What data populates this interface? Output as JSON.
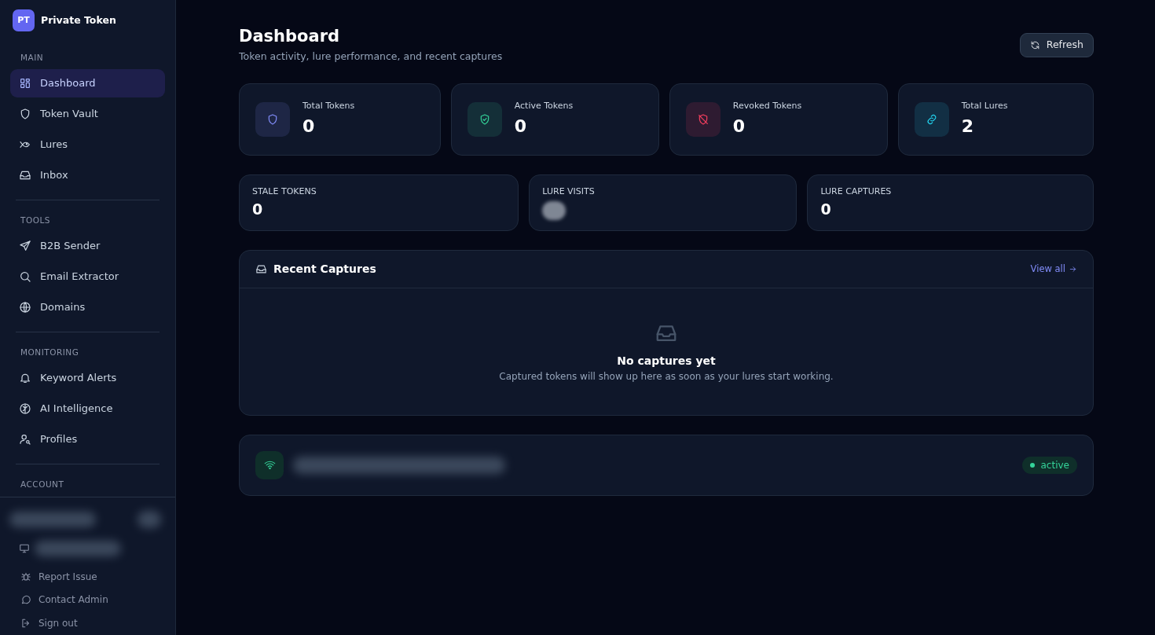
{
  "brand": {
    "initials": "PT",
    "name": "Private Token"
  },
  "sidebar": {
    "sections": [
      {
        "heading": "MAIN",
        "items": [
          {
            "label": "Dashboard",
            "selected": true
          },
          {
            "label": "Token Vault",
            "selected": false
          },
          {
            "label": "Lures",
            "selected": false
          },
          {
            "label": "Inbox",
            "selected": false
          }
        ]
      },
      {
        "heading": "TOOLS",
        "items": [
          {
            "label": "B2B Sender",
            "selected": false
          },
          {
            "label": "Email Extractor",
            "selected": false
          },
          {
            "label": "Domains",
            "selected": false
          }
        ]
      },
      {
        "heading": "MONITORING",
        "items": [
          {
            "label": "Keyword Alerts",
            "selected": false
          },
          {
            "label": "AI Intelligence",
            "selected": false
          },
          {
            "label": "Profiles",
            "selected": false
          }
        ]
      },
      {
        "heading": "ACCOUNT"
      }
    ],
    "footer_links": [
      {
        "label": "Report Issue"
      },
      {
        "label": "Contact Admin"
      },
      {
        "label": "Sign out"
      }
    ]
  },
  "header": {
    "title": "Dashboard",
    "subtitle": "Token activity, lure performance, and recent captures",
    "refresh_button": "Refresh"
  },
  "stat_cards": [
    {
      "label": "Total Tokens",
      "value": "0",
      "color": "#818cf8"
    },
    {
      "label": "Active Tokens",
      "value": "0",
      "color": "#34d399"
    },
    {
      "label": "Revoked Tokens",
      "value": "0",
      "color": "#f43f5e"
    },
    {
      "label": "Total Lures",
      "value": "2",
      "color": "#22d3ee"
    }
  ],
  "mini_stats": [
    {
      "label": "STALE TOKENS",
      "value": "0"
    },
    {
      "label": "LURE VISITS"
    },
    {
      "label": "LURE CAPTURES",
      "value": "0"
    }
  ],
  "recent_captures": {
    "title": "Recent Captures",
    "view_all": "View all",
    "empty_title": "No captures yet",
    "empty_text": "Captured tokens will show up here as soon as your lures start working."
  },
  "vps": {
    "status": "active"
  }
}
